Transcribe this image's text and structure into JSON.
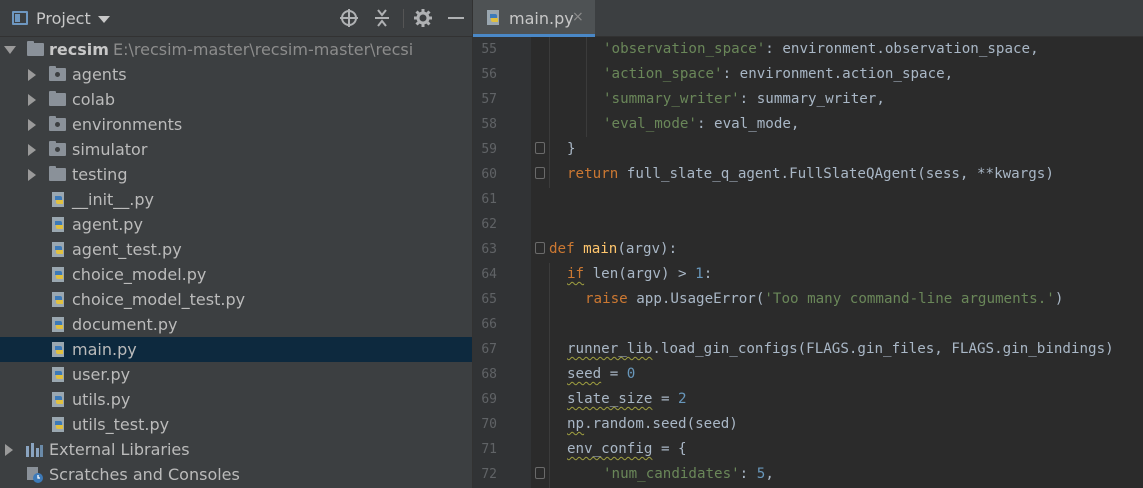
{
  "project_panel": {
    "title": "Project",
    "header_icons": [
      "crosshair-icon",
      "collapse-all-icon",
      "gear-icon",
      "minimize-icon"
    ],
    "root": {
      "name": "recsim",
      "path": "E:\\recsim-master\\recsim-master\\recsi"
    },
    "folders": [
      "agents",
      "colab",
      "environments",
      "simulator",
      "testing"
    ],
    "files": [
      "__init__.py",
      "agent.py",
      "agent_test.py",
      "choice_model.py",
      "choice_model_test.py",
      "document.py",
      "main.py",
      "user.py",
      "utils.py",
      "utils_test.py"
    ],
    "selected_file": "main.py",
    "external_libraries": "External Libraries",
    "scratches": "Scratches and Consoles"
  },
  "editor": {
    "tab": {
      "label": "main.py",
      "close": "×"
    },
    "line_numbers": [
      "55",
      "56",
      "57",
      "58",
      "59",
      "60",
      "61",
      "62",
      "63",
      "64",
      "65",
      "66",
      "67",
      "68",
      "69",
      "70",
      "71",
      "72"
    ],
    "lines": {
      "l55": {
        "key": "'observation_space'",
        "rest": ": environment.observation_space,"
      },
      "l56": {
        "key": "'action_space'",
        "rest": ": environment.action_space,"
      },
      "l57": {
        "key": "'summary_writer'",
        "rest": ": summary_writer,"
      },
      "l58": {
        "key": "'eval_mode'",
        "rest": ": eval_mode,"
      },
      "l59": "}",
      "l60": {
        "kw": "return",
        "rest": " full_slate_q_agent.FullSlateQAgent(sess, **kwargs)"
      },
      "l63": {
        "kw": "def",
        "fn": "main",
        "rest": "(argv):"
      },
      "l64": {
        "kw": "if",
        "rest_a": " len(argv) > ",
        "num": "1",
        "rest_b": ":"
      },
      "l65": {
        "kw": "raise",
        "rest_a": " app.UsageError(",
        "str": "'Too many command-line arguments.'",
        "rest_b": ")"
      },
      "l67": {
        "a": "runner_lib",
        "b": ".load_gin_configs(FLAGS.gin_files, FLAGS.gin_bindings)"
      },
      "l68": {
        "a": "seed",
        "b": " = ",
        "num": "0"
      },
      "l69": {
        "a": "slate_size",
        "b": " = ",
        "num": "2"
      },
      "l70": {
        "a": "np",
        "b": ".random.seed(seed)"
      },
      "l71": {
        "a": "env_config",
        "b": " = {"
      },
      "l72": {
        "key": "'num_candidates'",
        "rest": ": ",
        "num": "5",
        "tail": ","
      }
    }
  },
  "colors": {
    "keyword": "#cc7832",
    "string": "#6a8759",
    "number": "#6897bb",
    "function": "#ffc66d",
    "selection": "#0d293e",
    "accent": "#4a88c7"
  }
}
